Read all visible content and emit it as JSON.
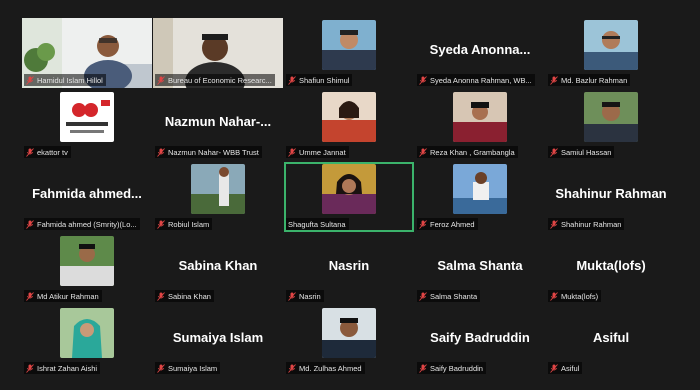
{
  "colors": {
    "background": "#1a1a1a",
    "speaker_highlight": "#3bb36b",
    "muted_mic": "#e04545"
  },
  "participants": [
    {
      "label": "Hamidul Islam Hillol",
      "big_name": "",
      "muted": true
    },
    {
      "label": "Bureau of Economic Researc...",
      "big_name": "",
      "muted": true
    },
    {
      "label": "Shafiun Shimul",
      "big_name": "",
      "muted": true
    },
    {
      "label": "Syeda Anonna Rahman, WB...",
      "big_name": "Syeda Anonna...",
      "muted": true
    },
    {
      "label": "Md. Bazlur Rahman",
      "big_name": "",
      "muted": true
    },
    {
      "label": "ekattor tv",
      "big_name": "",
      "muted": true,
      "logo_text": "ekattor.tv"
    },
    {
      "label": "Nazmun Nahar- WBB Trust",
      "big_name": "Nazmun Nahar-...",
      "muted": true
    },
    {
      "label": "Umme Jannat",
      "big_name": "",
      "muted": true
    },
    {
      "label": "Reza Khan , Grambangla",
      "big_name": "",
      "muted": true
    },
    {
      "label": "Samiul Hassan",
      "big_name": "",
      "muted": true
    },
    {
      "label": "Fahmida ahmed (Smrity)(Lo...",
      "big_name": "Fahmida ahmed...",
      "muted": true
    },
    {
      "label": "Robiul Islam",
      "big_name": "",
      "muted": true
    },
    {
      "label": "Shagufta Sultana",
      "big_name": "",
      "muted": false,
      "active_speaker": true
    },
    {
      "label": "Feroz Ahmed",
      "big_name": "",
      "muted": true
    },
    {
      "label": "Shahinur Rahman",
      "big_name": "Shahinur Rahman",
      "muted": true
    },
    {
      "label": "Md Atikur Rahman",
      "big_name": "",
      "muted": true
    },
    {
      "label": "Sabina Khan",
      "big_name": "Sabina Khan",
      "muted": true
    },
    {
      "label": "Nasrin",
      "big_name": "Nasrin",
      "muted": true
    },
    {
      "label": "Salma Shanta",
      "big_name": "Salma Shanta",
      "muted": true
    },
    {
      "label": "Mukta(lofs)",
      "big_name": "Mukta(lofs)",
      "muted": true
    },
    {
      "label": "Ishrat Zahan Aishi",
      "big_name": "",
      "muted": true
    },
    {
      "label": "Sumaiya Islam",
      "big_name": "Sumaiya Islam",
      "muted": true
    },
    {
      "label": "Md. Zulhas Ahmed",
      "big_name": "",
      "muted": true
    },
    {
      "label": "Saify Badruddin",
      "big_name": "Saify Badruddin",
      "muted": true
    },
    {
      "label": "Asiful",
      "big_name": "Asiful",
      "muted": true
    }
  ]
}
